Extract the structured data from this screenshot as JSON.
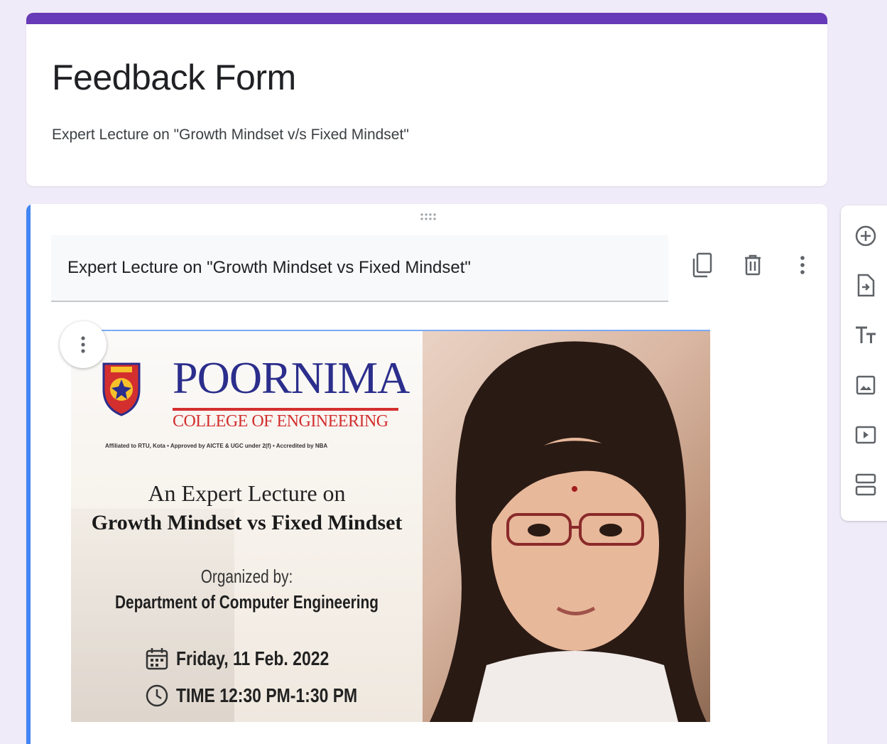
{
  "header": {
    "title": "Feedback Form",
    "description": "Expert Lecture on \"Growth Mindset v/s Fixed Mindset\""
  },
  "item": {
    "title": "Expert Lecture on \"Growth Mindset vs Fixed Mindset\"",
    "actions": [
      {
        "name": "duplicate",
        "icon": "duplicate-icon"
      },
      {
        "name": "delete",
        "icon": "trash-icon"
      },
      {
        "name": "more",
        "icon": "more-vert-icon"
      }
    ],
    "image": {
      "college_name": "POORNIMA",
      "college_subtitle": "COLLEGE OF ENGINEERING",
      "affiliation": "Affiliated to RTU, Kota • Approved by AICTE & UGC under 2(f) • Accredited by NBA",
      "intro": "An Expert Lecture on",
      "topic": "Growth Mindset vs Fixed Mindset",
      "organized_label": "Organized by:",
      "department": "Department of Computer Engineering",
      "date": "Friday, 11 Feb. 2022",
      "time": "TIME 12:30 PM-1:30 PM"
    }
  },
  "toolbar": {
    "items": [
      {
        "name": "add-question",
        "icon": "add-circle-icon"
      },
      {
        "name": "import-questions",
        "icon": "import-icon"
      },
      {
        "name": "add-title-description",
        "icon": "text-title-icon"
      },
      {
        "name": "add-image",
        "icon": "image-icon"
      },
      {
        "name": "add-video",
        "icon": "video-icon"
      },
      {
        "name": "add-section",
        "icon": "section-icon"
      }
    ]
  },
  "colors": {
    "theme_accent": "#673ab7",
    "active_item_accent": "#4285f4",
    "background": "#f0ebf8",
    "icon": "#5f6368"
  }
}
